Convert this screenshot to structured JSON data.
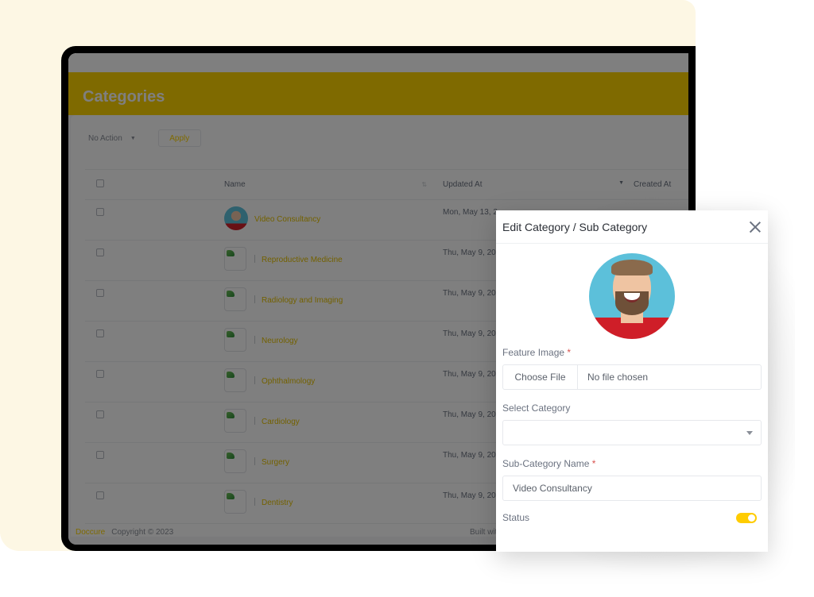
{
  "page": {
    "title": "Categories",
    "toolbar": {
      "bulk_action": "No Action",
      "apply_label": "Apply"
    },
    "table": {
      "headers": {
        "name": "Name",
        "updated_at": "Updated At",
        "created_at": "Created At"
      },
      "rows": [
        {
          "name": "Video Consultancy",
          "updated_at": "Mon, May 13, 2",
          "thumb": "photo"
        },
        {
          "name": "Reproductive Medicine",
          "updated_at": "Thu, May 9, 20",
          "thumb": "broken"
        },
        {
          "name": "Radiology and Imaging",
          "updated_at": "Thu, May 9, 20",
          "thumb": "broken"
        },
        {
          "name": "Neurology",
          "updated_at": "Thu, May 9, 20",
          "thumb": "broken"
        },
        {
          "name": "Ophthalmology",
          "updated_at": "Thu, May 9, 20",
          "thumb": "broken"
        },
        {
          "name": "Cardiology",
          "updated_at": "Thu, May 9, 20",
          "thumb": "broken"
        },
        {
          "name": "Surgery",
          "updated_at": "Thu, May 9, 20",
          "thumb": "broken"
        },
        {
          "name": "Dentistry",
          "updated_at": "Thu, May 9, 20",
          "thumb": "broken"
        }
      ]
    },
    "footer": {
      "brand": "Doccure",
      "copyright": "Copyright © 2023",
      "built": "Built with"
    }
  },
  "modal": {
    "title": "Edit Category / Sub Category",
    "feature_image_label": "Feature Image",
    "required_mark": "*",
    "choose_file_label": "Choose File",
    "file_status": "No file chosen",
    "select_category_label": "Select Category",
    "select_category_value": "",
    "subcategory_name_label": "Sub-Category Name",
    "subcategory_name_value": "Video Consultancy",
    "status_label": "Status",
    "status_on": true
  },
  "colors": {
    "accent": "#ffd400",
    "cream": "#fdf7e4"
  }
}
